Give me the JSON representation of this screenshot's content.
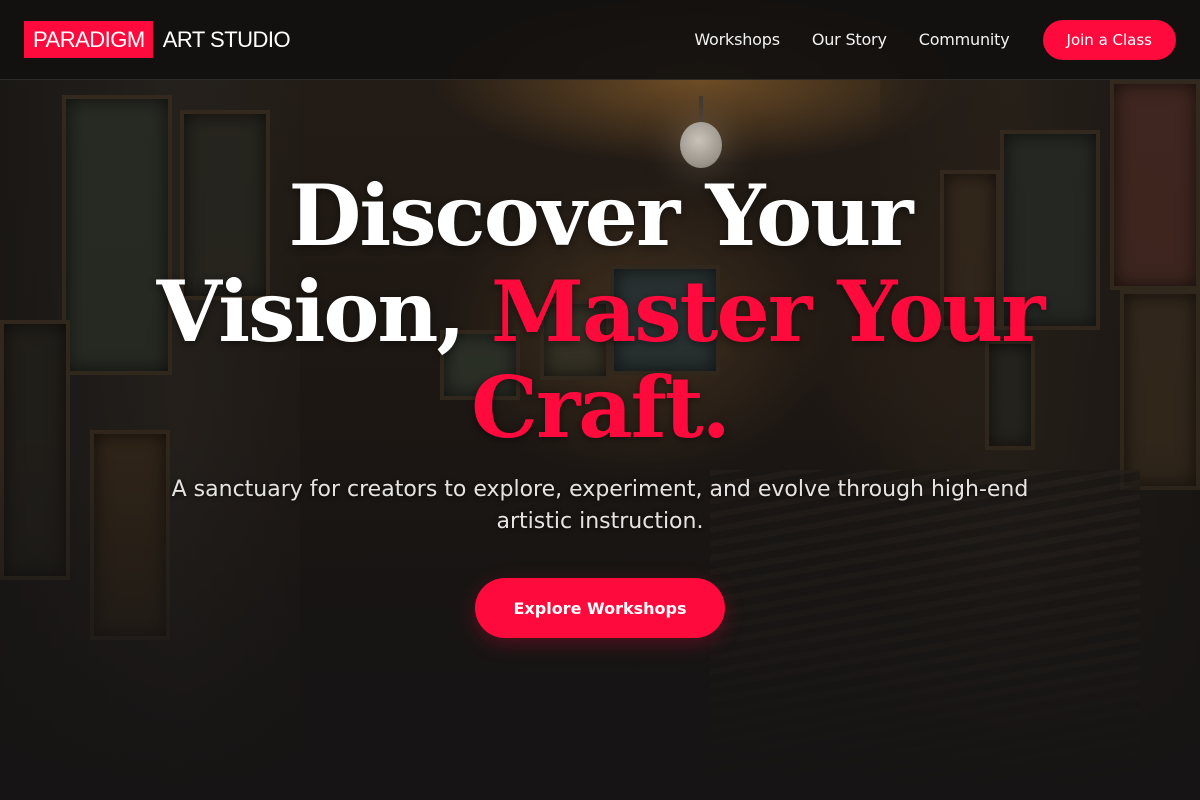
{
  "colors": {
    "accent": "#ff0a3c",
    "header_bg": "#121010",
    "text": "#ffffff"
  },
  "header": {
    "brand_mark": "PARADIGM",
    "brand_name": "ART STUDIO",
    "nav": [
      {
        "label": "Workshops"
      },
      {
        "label": "Our Story"
      },
      {
        "label": "Community"
      }
    ],
    "cta_label": "Join a Class"
  },
  "hero": {
    "headline_white": "Discover Your Vision,",
    "headline_accent": "Master Your Craft.",
    "subheadline": "A sanctuary for creators to explore, experiment, and evolve through high-end artistic instruction.",
    "cta_label": "Explore Workshops"
  }
}
